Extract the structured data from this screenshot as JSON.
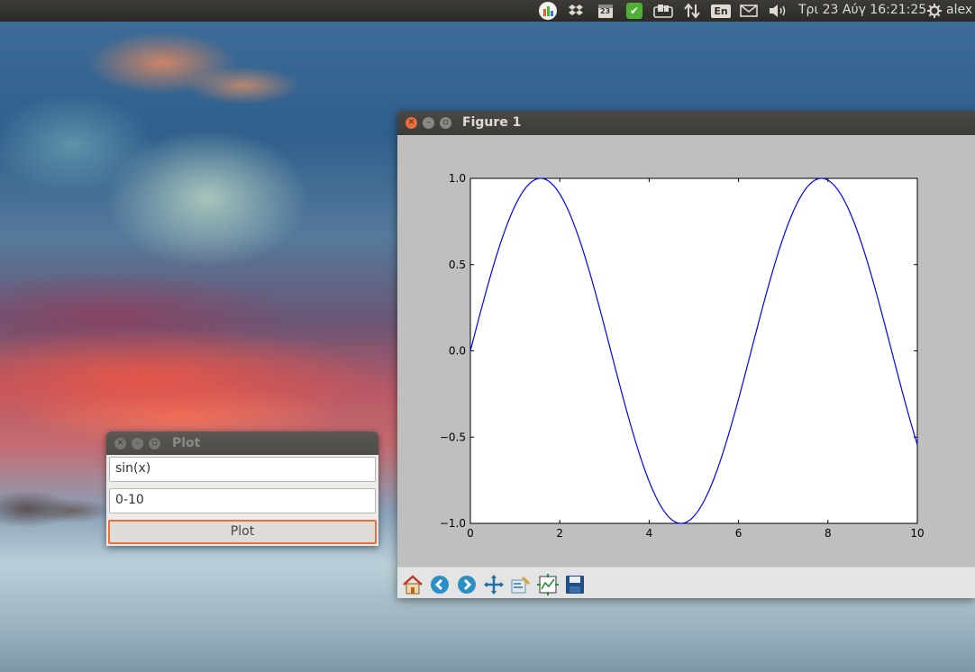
{
  "top_panel": {
    "tray_icons": [
      "system-monitor-icon",
      "dropbox-icon",
      "calendar-icon",
      "update-ok-icon",
      "shelf-icon",
      "network-updown-icon",
      "keyboard-layout-icon",
      "mail-icon",
      "volume-icon"
    ],
    "calendar_day": "23",
    "keyboard_layout": "En",
    "clock": "Τρι 23 Αύγ 16:21:25",
    "user": "alex",
    "colors": {
      "panel": "#3c3b37",
      "text": "#dfdbd2",
      "green": "#4fb033"
    }
  },
  "plot_window": {
    "title": "Plot",
    "function_input": {
      "value": "sin(x)"
    },
    "range_input": {
      "value": "0-10"
    },
    "plot_button": "Plot",
    "accent": "#e9703b"
  },
  "figure_window": {
    "title": "Figure 1",
    "toolbar": [
      "home-icon",
      "back-icon",
      "forward-icon",
      "pan-icon",
      "zoom-icon",
      "subplots-icon",
      "save-icon"
    ]
  },
  "chart_data": {
    "type": "line",
    "function": "sin(x)",
    "xlim": [
      0,
      10
    ],
    "ylim": [
      -1.0,
      1.0
    ],
    "x_ticks": [
      "0",
      "2",
      "4",
      "6",
      "8",
      "10"
    ],
    "y_ticks": [
      "1.0",
      "0.5",
      "0.0",
      "−0.5",
      "−1.0"
    ],
    "series": [
      {
        "color": "#0000ff",
        "x": [
          0,
          0.5,
          1,
          1.5,
          1.571,
          2,
          2.5,
          3,
          3.5,
          4,
          4.5,
          4.712,
          5,
          5.5,
          6,
          6.5,
          7,
          7.5,
          7.854,
          8,
          8.5,
          9,
          9.5,
          10
        ],
        "y": [
          0,
          0.479,
          0.841,
          0.997,
          1.0,
          0.909,
          0.598,
          0.141,
          -0.351,
          -0.757,
          -0.978,
          -1.0,
          -0.959,
          -0.706,
          -0.279,
          0.215,
          0.657,
          0.938,
          1.0,
          0.989,
          0.798,
          0.412,
          -0.075,
          -0.544
        ]
      }
    ],
    "grid": false
  }
}
